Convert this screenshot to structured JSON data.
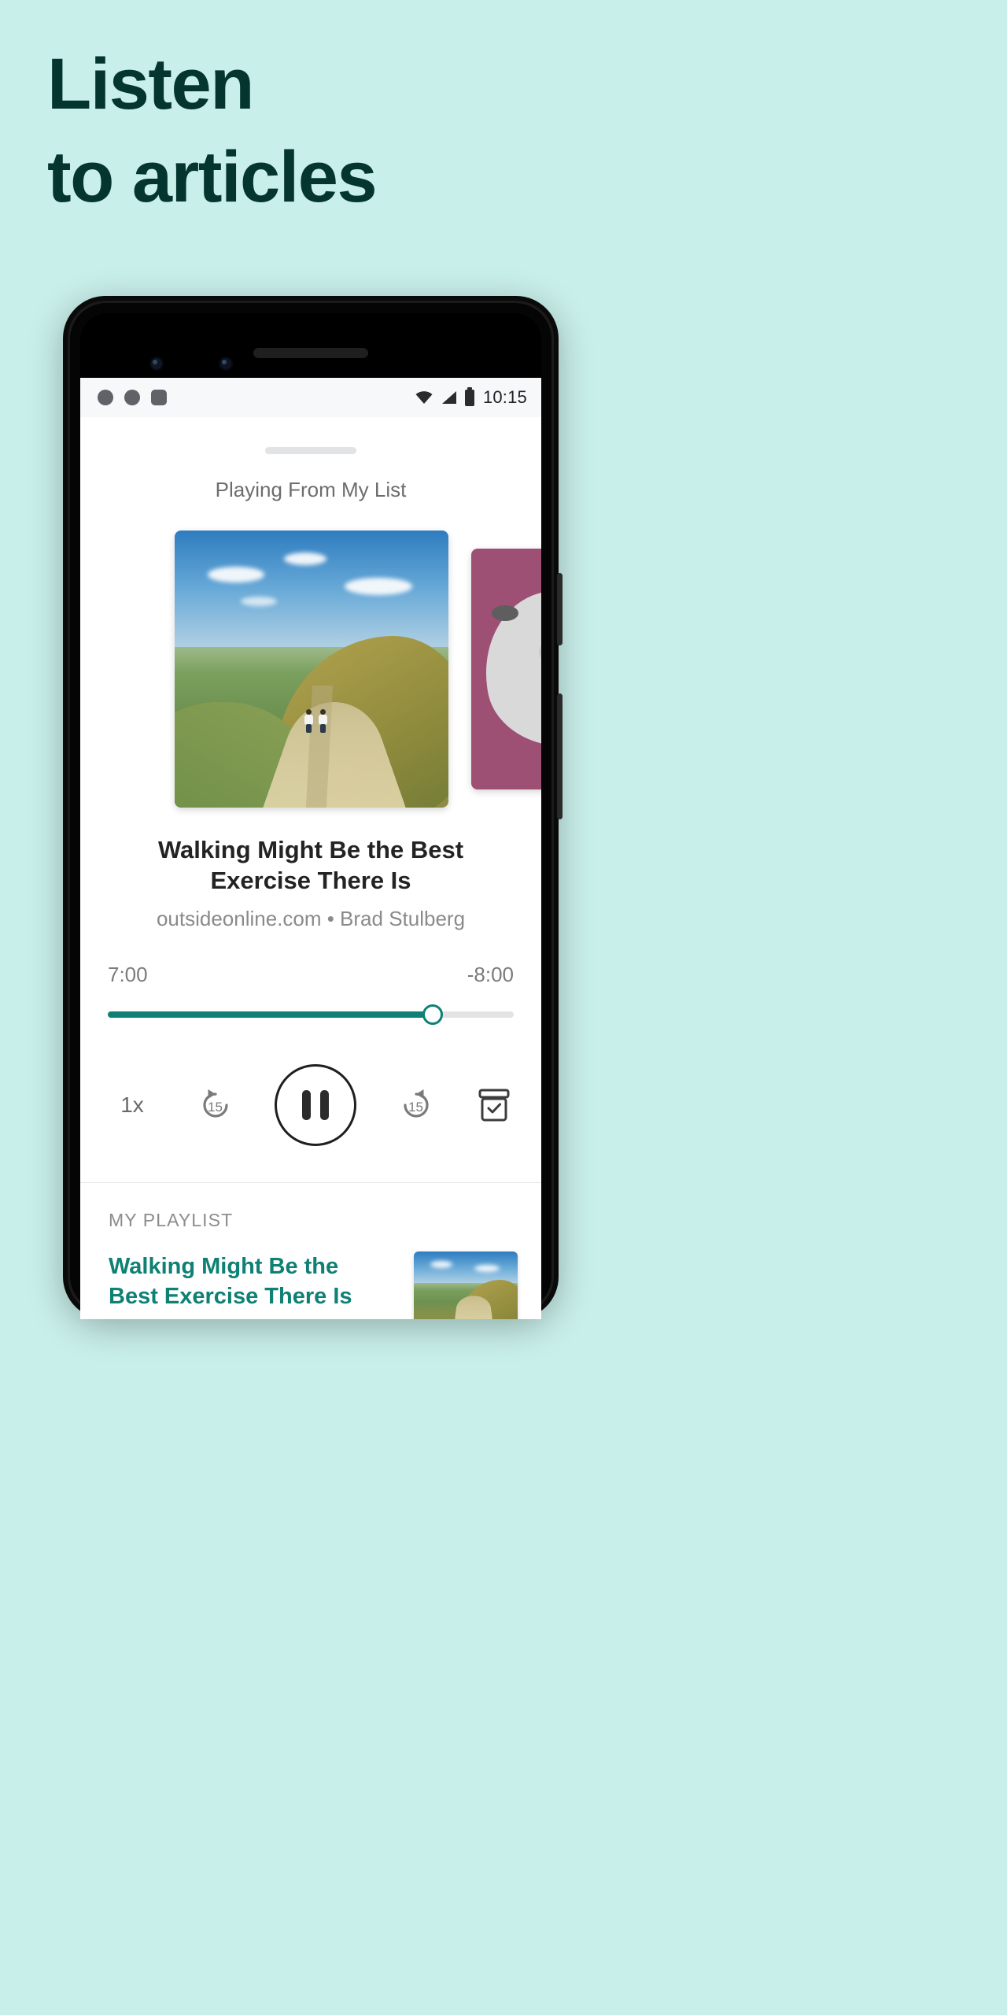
{
  "page": {
    "background_color": "#C9EFEA",
    "headline_color": "#04352E",
    "accent_color": "#0E8074"
  },
  "headline": {
    "line1": "Listen",
    "line2": "to articles"
  },
  "phone": {
    "statusbar": {
      "icons_left": [
        "notification-dot",
        "notification-dot",
        "notification-square"
      ],
      "wifi_icon": "wifi-icon",
      "signal_icon": "cell-signal-icon",
      "battery_icon": "battery-icon",
      "time": "10:15"
    },
    "player": {
      "drag_handle": "sheet-drag-handle",
      "source_label": "Playing From My List",
      "artwork_main_alt": "two walkers on a grassy hillside path",
      "artwork_next_color": "#9E4F74",
      "title": "Walking Might Be the Best Exercise There Is",
      "byline": "outsideonline.com • Brad Stulberg",
      "elapsed": "7:00",
      "remaining": "-8:00",
      "progress_percent": 80,
      "controls": {
        "speed": "1x",
        "rewind_label": "15",
        "rewind_icon": "replay-15-icon",
        "playpause_icon": "pause-icon",
        "forward_label": "15",
        "forward_icon": "forward-15-icon",
        "archive_icon": "archive-icon"
      }
    },
    "playlist": {
      "header": "MY PLAYLIST",
      "items": [
        {
          "title": "Walking Might Be the Best Exercise There Is",
          "thumbnail_alt": "hillside path photo"
        }
      ]
    }
  }
}
